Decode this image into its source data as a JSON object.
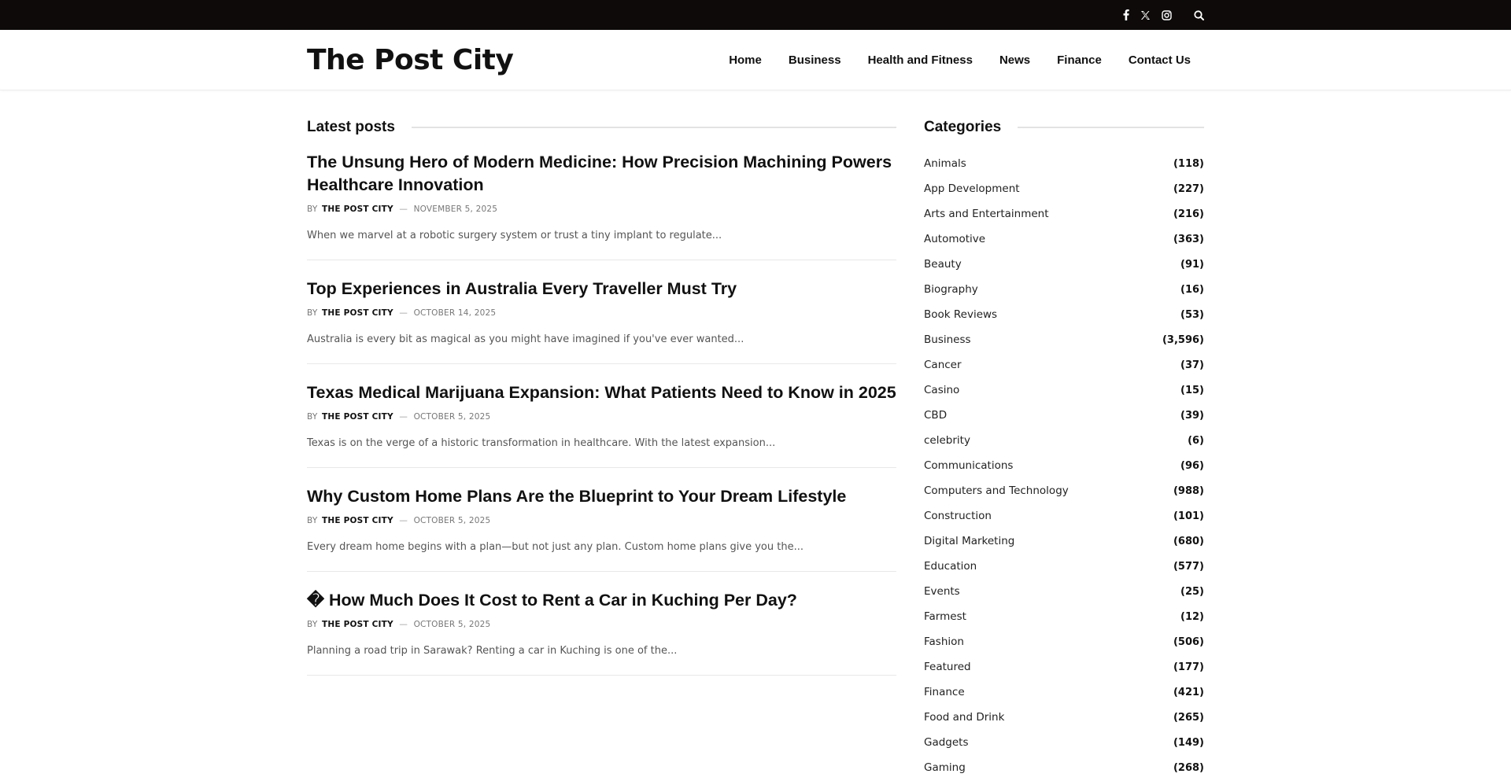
{
  "topbar": {
    "social": [
      {
        "icon": "facebook-icon",
        "glyph": "f"
      },
      {
        "icon": "x-twitter-icon",
        "glyph": "x"
      },
      {
        "icon": "instagram-icon",
        "glyph": "ig"
      }
    ],
    "search_icon": "search-icon"
  },
  "header": {
    "logo": "The Post City",
    "nav": [
      "Home",
      "Business",
      "Health and Fitness",
      "News",
      "Finance",
      "Contact Us"
    ]
  },
  "main": {
    "section_title": "Latest posts",
    "posts": [
      {
        "title": "The Unsung Hero of Modern Medicine: How Precision Machining Powers Healthcare Innovation",
        "by": "BY",
        "author": "THE POST CITY",
        "sep": "—",
        "date": "NOVEMBER 5, 2025",
        "excerpt": "When we marvel at a robotic surgery system or trust a tiny implant to regulate..."
      },
      {
        "title": "Top Experiences in Australia Every Traveller Must Try",
        "by": "BY",
        "author": "THE POST CITY",
        "sep": "—",
        "date": "OCTOBER 14, 2025",
        "excerpt": "Australia is every bit as magical as you might have imagined if you've ever wanted..."
      },
      {
        "title": "Texas Medical Marijuana Expansion: What Patients Need to Know in 2025",
        "by": "BY",
        "author": "THE POST CITY",
        "sep": "—",
        "date": "OCTOBER 5, 2025",
        "excerpt": "Texas is on the verge of a historic transformation in healthcare. With the latest expansion..."
      },
      {
        "title": "Why Custom Home Plans Are the Blueprint to Your Dream Lifestyle",
        "by": "BY",
        "author": "THE POST CITY",
        "sep": "—",
        "date": "OCTOBER 5, 2025",
        "excerpt": "Every dream home begins with a plan—but not just any plan. Custom home plans give you the..."
      },
      {
        "title": "� How Much Does It Cost to Rent a Car in Kuching Per Day?",
        "by": "BY",
        "author": "THE POST CITY",
        "sep": "—",
        "date": "OCTOBER 5, 2025",
        "excerpt": "Planning a road trip in Sarawak? Renting a car in Kuching is one of the..."
      }
    ]
  },
  "sidebar": {
    "title": "Categories",
    "categories": [
      {
        "name": "Animals",
        "count": "(118)"
      },
      {
        "name": "App Development",
        "count": "(227)"
      },
      {
        "name": "Arts and Entertainment",
        "count": "(216)"
      },
      {
        "name": "Automotive",
        "count": "(363)"
      },
      {
        "name": "Beauty",
        "count": "(91)"
      },
      {
        "name": "Biography",
        "count": "(16)"
      },
      {
        "name": "Book Reviews",
        "count": "(53)"
      },
      {
        "name": "Business",
        "count": "(3,596)"
      },
      {
        "name": "Cancer",
        "count": "(37)"
      },
      {
        "name": "Casino",
        "count": "(15)"
      },
      {
        "name": "CBD",
        "count": "(39)"
      },
      {
        "name": "celebrity",
        "count": "(6)"
      },
      {
        "name": "Communications",
        "count": "(96)"
      },
      {
        "name": "Computers and Technology",
        "count": "(988)"
      },
      {
        "name": "Construction",
        "count": "(101)"
      },
      {
        "name": "Digital Marketing",
        "count": "(680)"
      },
      {
        "name": "Education",
        "count": "(577)"
      },
      {
        "name": "Events",
        "count": "(25)"
      },
      {
        "name": "Farmest",
        "count": "(12)"
      },
      {
        "name": "Fashion",
        "count": "(506)"
      },
      {
        "name": "Featured",
        "count": "(177)"
      },
      {
        "name": "Finance",
        "count": "(421)"
      },
      {
        "name": "Food and Drink",
        "count": "(265)"
      },
      {
        "name": "Gadgets",
        "count": "(149)"
      },
      {
        "name": "Gaming",
        "count": "(268)"
      }
    ]
  }
}
